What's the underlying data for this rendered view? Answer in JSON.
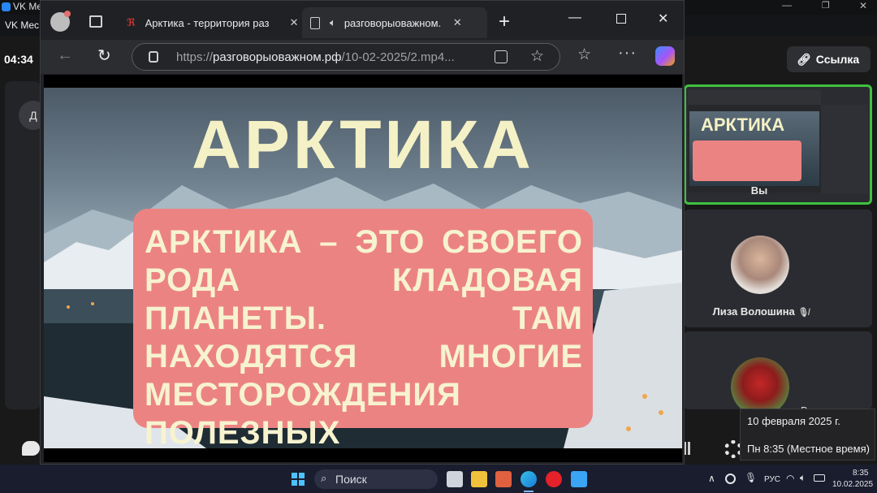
{
  "vk": {
    "window_title": "VK Me",
    "tab_label": "VK Mec",
    "time": "04:34",
    "side_button": "Д",
    "link_button": "Ссылка",
    "tiles": {
      "self_name": "Вы",
      "p2_name": "Лиза Волошина",
      "p3_name": "В"
    }
  },
  "browser": {
    "tab1_title": "Арктика - территория раз",
    "tab2_title": "разговорыоважном.",
    "url_scheme": "https://",
    "url_host": "разговорыоважном.рф",
    "url_path": "/10-02-2025/2.mp4..."
  },
  "slide": {
    "title": "АРКТИКА",
    "body": "АРКТИКА – ЭТО СВОЕГО РОДА КЛАДОВАЯ ПЛАНЕТЫ. ТАМ НАХОДЯТСЯ МНОГИЕ МЕСТОРОЖДЕНИЯ ПОЛЕЗНЫХ ИСКОПАЕМЫХ."
  },
  "taskbar": {
    "search_label": "Поиск",
    "lang": "РУС",
    "clock_time": "8:35",
    "clock_date": "10.02.2025"
  },
  "date_popup": {
    "date": "10 февраля 2025 г.",
    "weekday_time": "Пн 8:35 (Местное время)"
  },
  "colors": {
    "accent_green": "#3fc13f",
    "slide_box": "#ec8383",
    "slide_text": "#f7f3cf"
  }
}
